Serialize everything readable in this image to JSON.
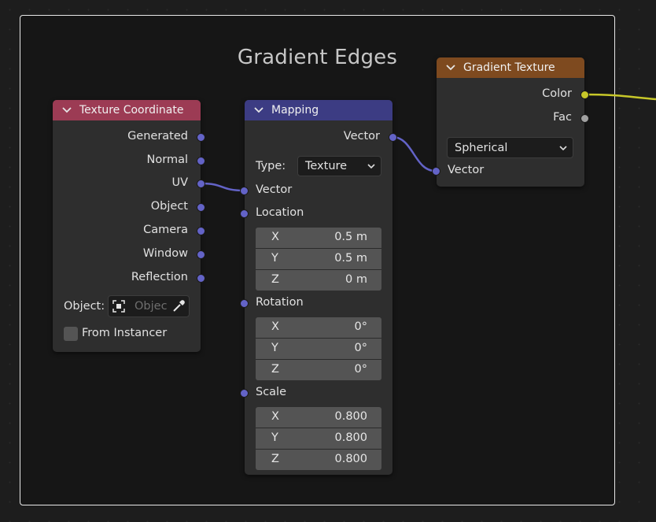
{
  "frame": {
    "title": "Gradient Edges"
  },
  "colors": {
    "texture_header": "#9c3b54",
    "mapping_header": "#3c3c83",
    "gradient_header": "#7e4a1f",
    "vector_socket": "#6363c7",
    "color_socket": "#c7c729",
    "float_socket": "#a1a1a1"
  },
  "texture_coordinate": {
    "title": "Texture Coordinate",
    "outputs": [
      "Generated",
      "Normal",
      "UV",
      "Object",
      "Camera",
      "Window",
      "Reflection"
    ],
    "object_label": "Object:",
    "object_placeholder": "Objec",
    "from_instancer": "From Instancer"
  },
  "mapping": {
    "title": "Mapping",
    "output_vector": "Vector",
    "type_label": "Type:",
    "type_value": "Texture",
    "input_vector": "Vector",
    "location_label": "Location",
    "location": {
      "x": "0.5 m",
      "y": "0.5 m",
      "z": "0 m"
    },
    "rotation_label": "Rotation",
    "rotation": {
      "x": "0°",
      "y": "0°",
      "z": "0°"
    },
    "scale_label": "Scale",
    "scale": {
      "x": "0.800",
      "y": "0.800",
      "z": "0.800"
    },
    "axes": {
      "x": "X",
      "y": "Y",
      "z": "Z"
    }
  },
  "gradient_texture": {
    "title": "Gradient Texture",
    "output_color": "Color",
    "output_fac": "Fac",
    "gradient_type": "Spherical",
    "input_vector": "Vector"
  }
}
